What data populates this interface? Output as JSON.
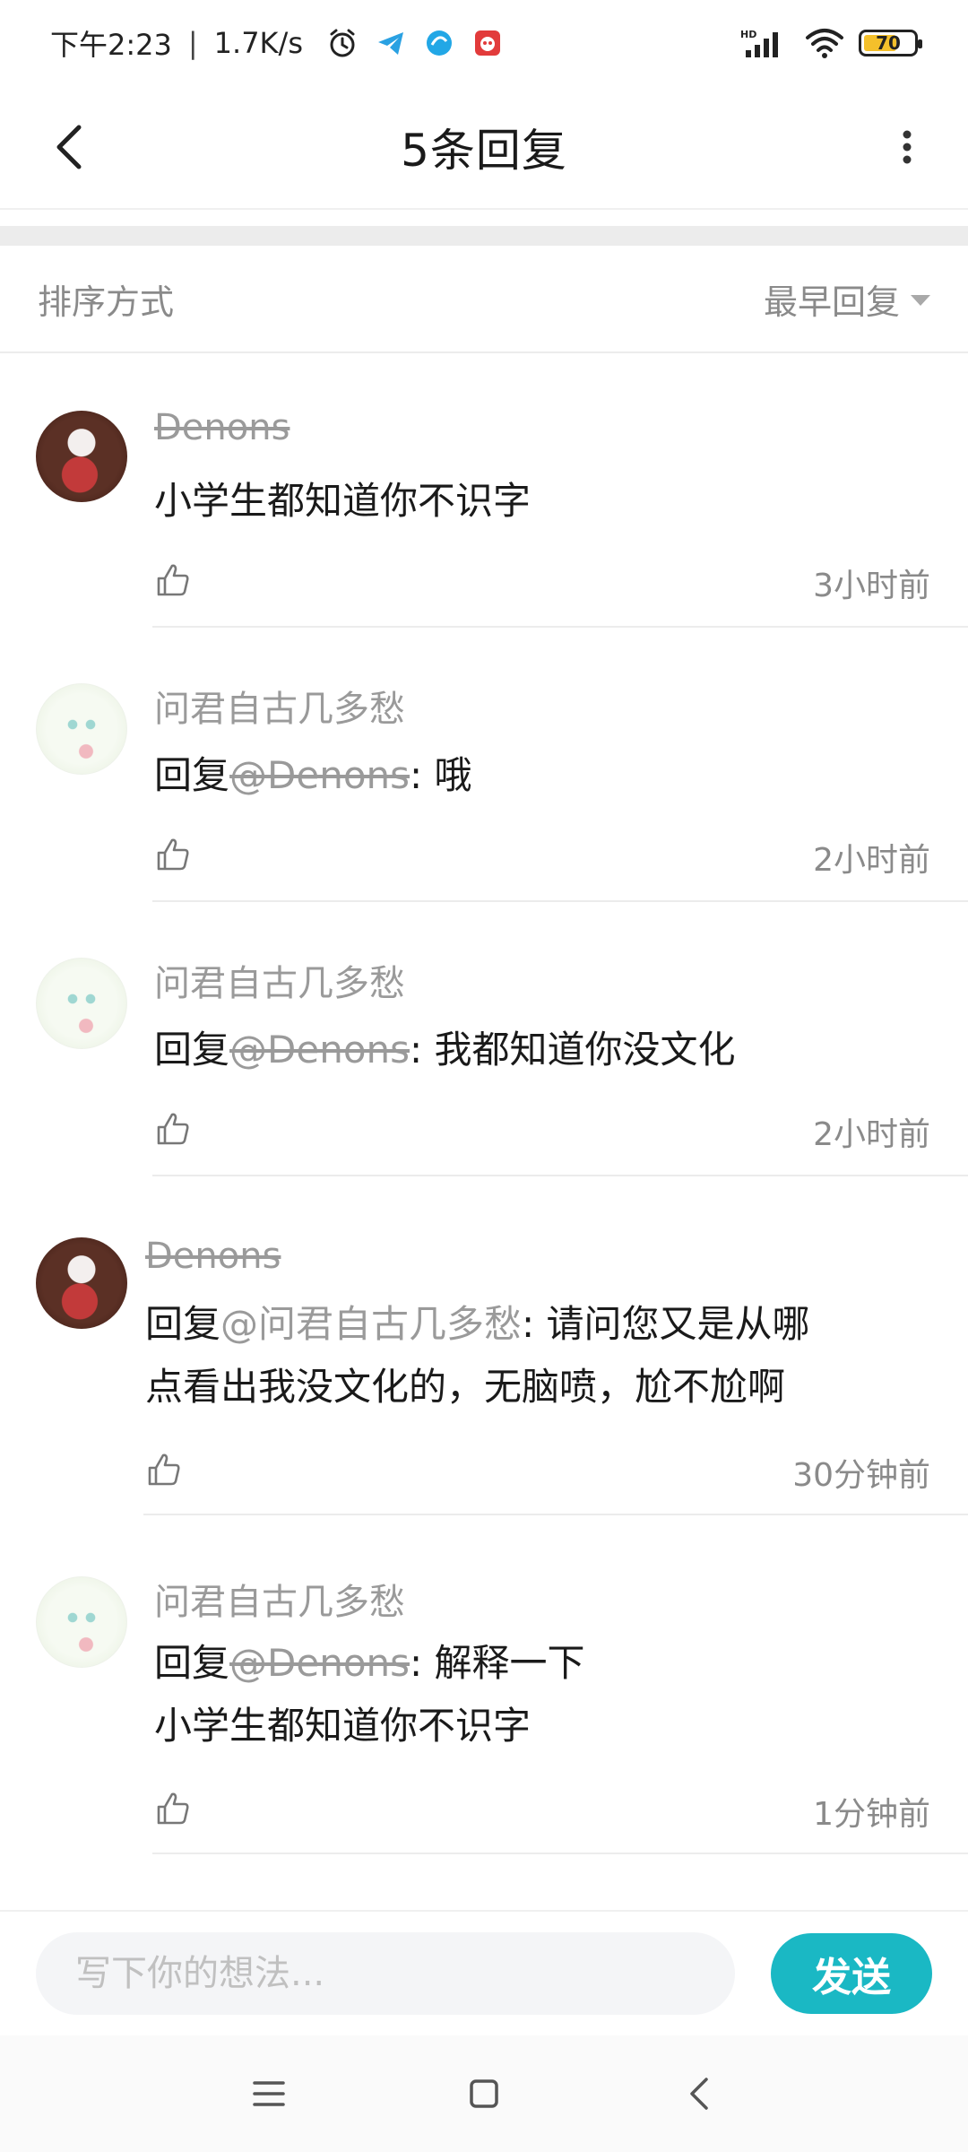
{
  "status_bar": {
    "time": "下午2:23",
    "separator": "|",
    "net_speed": "1.7K/s",
    "battery_level": "70",
    "icons": [
      "alarm-icon",
      "telegram-icon",
      "app-icon",
      "app-icon-red",
      "hd-icon",
      "signal-icon",
      "wifi-icon",
      "battery-icon"
    ]
  },
  "header": {
    "title": "5条回复"
  },
  "sort": {
    "label": "排序方式",
    "selected": "最早回复"
  },
  "replies": [
    {
      "author": "Denons",
      "author_struck": true,
      "avatar": "avatar-a",
      "prefix": "",
      "mention": "",
      "text": "小学生都知道你不识字",
      "text2": "",
      "time": "3小时前"
    },
    {
      "author": "问君自古几多愁",
      "author_struck": false,
      "avatar": "avatar-b",
      "prefix": "回复",
      "mention": "@Denons",
      "text": ": 哦",
      "text2": "",
      "time": "2小时前"
    },
    {
      "author": "问君自古几多愁",
      "author_struck": false,
      "avatar": "avatar-b",
      "prefix": "回复",
      "mention": "@Denons",
      "text": ": 我都知道你没文化",
      "text2": "",
      "time": "2小时前"
    },
    {
      "author": "Denons",
      "author_struck": true,
      "avatar": "avatar-a",
      "prefix": "回复",
      "mention": "@问君自古几多愁",
      "text": ": 请问您又是从哪",
      "text2": "点看出我没文化的，无脑喷，尬不尬啊",
      "time": "30分钟前"
    },
    {
      "author": "问君自古几多愁",
      "author_struck": false,
      "avatar": "avatar-b",
      "prefix": "回复",
      "mention": "@Denons",
      "text": ": 解释一下",
      "text2": "小学生都知道你不识字",
      "time": "1分钟前"
    }
  ],
  "composer": {
    "placeholder": "写下你的想法...",
    "send_label": "发送"
  },
  "nav": {
    "icons": [
      "menu-icon",
      "home-icon",
      "back-icon"
    ]
  },
  "colors": {
    "accent": "#1ab8c4",
    "muted_text": "#9a9a9a",
    "battery_fill": "#f4c02b"
  }
}
